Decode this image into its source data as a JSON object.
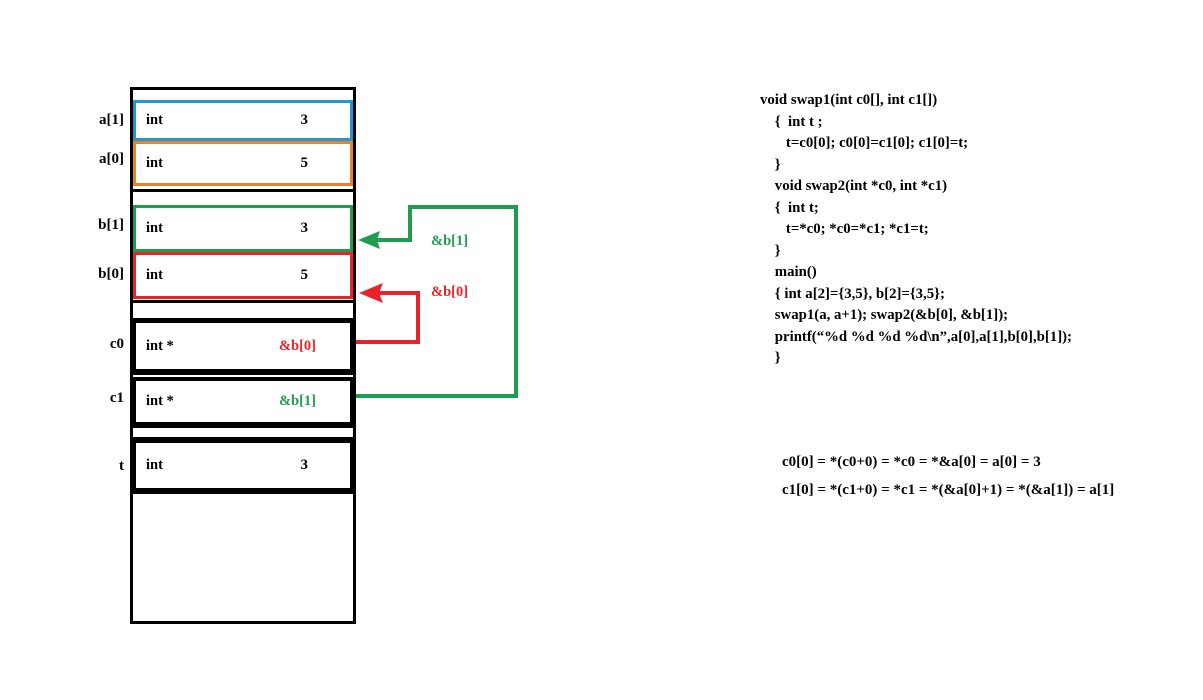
{
  "diagram": {
    "title": "C pointer swap memory layout",
    "colors": {
      "a1": "#2196cf",
      "a0": "#e8832a",
      "b1": "#1f9d4f",
      "b0": "#e8232a",
      "t": "#000000",
      "frame": "#000000",
      "red": "#e8232a",
      "green": "#1f9d4f"
    },
    "cells": [
      {
        "label": "a[1]",
        "type": "int",
        "value": "3",
        "border": "#2196cf"
      },
      {
        "label": "a[0]",
        "type": "int",
        "value": "5",
        "border": "#e8832a"
      },
      {
        "label": "b[1]",
        "type": "int",
        "value": "3",
        "border": "#1f9d4f"
      },
      {
        "label": "b[0]",
        "type": "int",
        "value": "5",
        "border": "#e8232a"
      },
      {
        "label": "c0",
        "type": "int *",
        "value": "&b[0]",
        "border": "#000000"
      },
      {
        "label": "c1",
        "type": "int *",
        "value": "&b[1]",
        "border": "#000000"
      },
      {
        "label": "t",
        "type": "int",
        "value": "3",
        "border": "#000000"
      }
    ],
    "annotations": [
      {
        "name": "pointer-label-b1",
        "text": "&b[1]",
        "color": "#1f9d4f"
      },
      {
        "name": "pointer-label-b0",
        "text": "&b[0]",
        "color": "#e8232a"
      }
    ]
  },
  "code": {
    "lines": [
      "void swap1(int c0[], int c1[])",
      "    {  int t ;",
      "       t=c0[0]; c0[0]=c1[0]; c1[0]=t;",
      "    }",
      "    void swap2(int *c0, int *c1)",
      "    {  int t;",
      "       t=*c0; *c0=*c1; *c1=t;",
      "    }",
      "    main()",
      "    { int a[2]={3,5}, b[2]={3,5};",
      "    swap1(a, a+1); swap2(&b[0], &b[1]);",
      "    printf(“%d %d %d %d\\n”,a[0],a[1],b[0],b[1]);",
      "    }"
    ]
  },
  "equations": {
    "lines": [
      "c0[0] = *(c0+0) = *c0 = *&a[0] = a[0] = 3",
      "c1[0] = *(c1+0) = *c1 = *(&a[0]+1) = *(&a[1]) = a[1]"
    ]
  }
}
